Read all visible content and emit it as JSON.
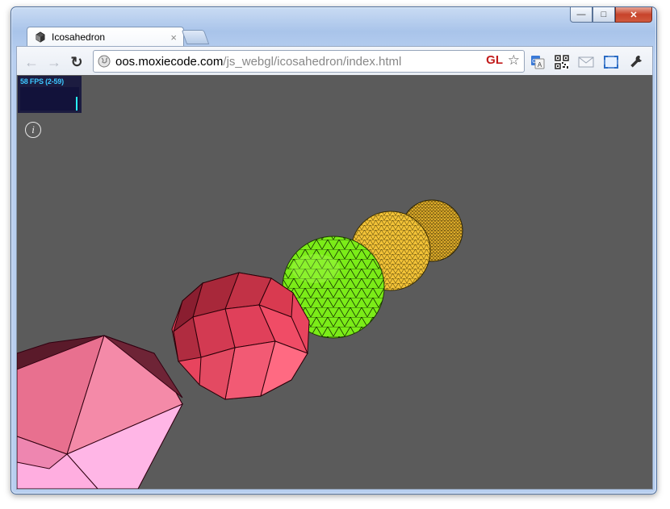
{
  "window": {
    "tab_title": "Icosahedron",
    "tab_close": "×",
    "minimize": "—",
    "maximize": "□",
    "close": "✕"
  },
  "toolbar": {
    "back": "←",
    "forward": "→",
    "reload": "↻",
    "url_host": "oos.moxiecode.com",
    "url_path": "/js_webgl/icosahedron/index.html",
    "gl_label": "GL",
    "star": "☆"
  },
  "extensions": [
    {
      "name": "translate-icon"
    },
    {
      "name": "qr-code-icon"
    },
    {
      "name": "mail-icon"
    },
    {
      "name": "fullscreen-icon"
    },
    {
      "name": "wrench-icon"
    }
  ],
  "stats": {
    "fps_text": "58 FPS (2-59)",
    "fps": 58,
    "fps_min": 2,
    "fps_max": 59
  },
  "info_glyph": "i",
  "colors": {
    "viewport_bg": "#5b5b5b",
    "pink": "#f07ea4",
    "red": "#e8405a",
    "green": "#7ef01a",
    "yellow": "#f2c237",
    "gold": "#e0ae2a"
  }
}
